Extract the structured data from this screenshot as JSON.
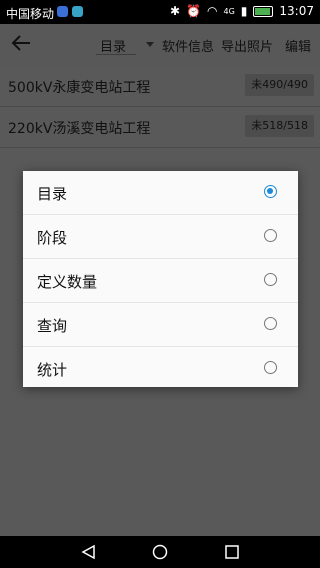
{
  "status_bar": {
    "carrier": "中国移动",
    "network": "4G",
    "time": "13:07",
    "app_icon_colors": [
      "#3b6fd6",
      "#36a3c7"
    ]
  },
  "toolbar": {
    "dropdown_value": "目录",
    "actions": [
      "软件信息",
      "导出照片",
      "编辑"
    ]
  },
  "projects": [
    {
      "name": "500kV永康变电站工程",
      "badge": "未490/490"
    },
    {
      "name": "220kV汤溪变电站工程",
      "badge": "未518/518"
    }
  ],
  "dialog": {
    "options": [
      {
        "label": "目录",
        "selected": true
      },
      {
        "label": "阶段",
        "selected": false
      },
      {
        "label": "定义数量",
        "selected": false
      },
      {
        "label": "查询",
        "selected": false
      },
      {
        "label": "统计",
        "selected": false
      }
    ],
    "accent_color": "#1c8ad8"
  }
}
